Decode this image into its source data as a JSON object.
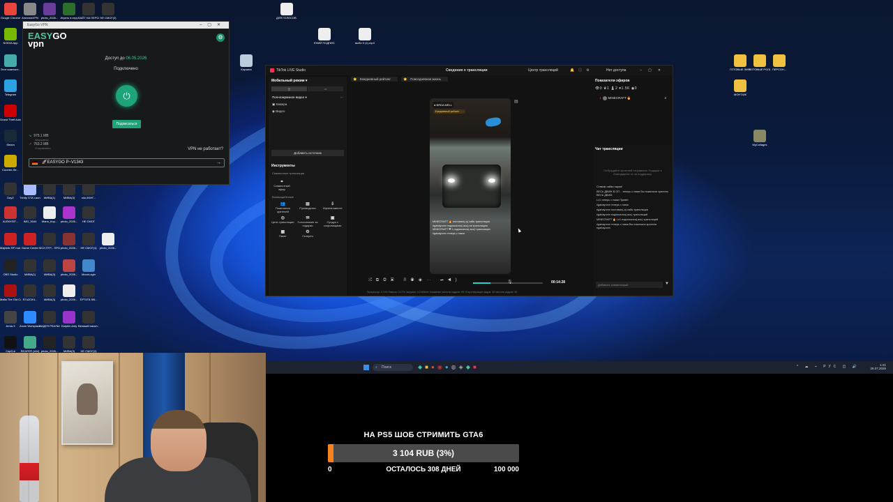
{
  "desktop": {
    "icons": [
      {
        "label": "Google Chrome",
        "color": "#e8453c"
      },
      {
        "label": "AmneziaVPN",
        "color": "#888"
      },
      {
        "label": "photo_2026...",
        "color": "#6a3d9a"
      },
      {
        "label": "Играть в игру",
        "color": "#2c6e2c"
      },
      {
        "label": "БАЙТ НА ПЕРСОН...",
        "color": "#333"
      },
      {
        "label": "НЕ СМОГ(2)",
        "color": "#333"
      },
      {
        "label": "ДЛЯ ГОЛОСОВ...",
        "color": "#eee"
      },
      {
        "label": "Корзина",
        "color": "#bcd"
      },
      {
        "label": "ЕНИЙ ПОДПИСКА...",
        "color": "#eee"
      },
      {
        "label": "выбо 0 (1).mp4",
        "color": "#eee"
      },
      {
        "label": "ГОТОВЫЕ ЛИФС",
        "color": "#f0c040"
      },
      {
        "label": "ГОТОВЫЕ РОЛИКИ",
        "color": "#f0c040"
      },
      {
        "label": "ПЕРСОН...",
        "color": "#f0c040"
      },
      {
        "label": "МОНТАЖ",
        "color": "#f0c040"
      },
      {
        "label": "MyCollages",
        "color": "#886"
      },
      {
        "label": "NVIDIA App",
        "color": "#76b900"
      },
      {
        "label": "Этот компьют...",
        "color": "#4aa"
      },
      {
        "label": "Telegram",
        "color": "#2aa3e0"
      },
      {
        "label": "Grand Theft Auto III - T...",
        "color": "#c00"
      },
      {
        "label": "Steam",
        "color": "#1b2838"
      },
      {
        "label": "Counter-Str...",
        "color": "#ca0"
      },
      {
        "label": "DayZ",
        "color": "#333"
      },
      {
        "label": "Trinity GTA Launcher",
        "color": "#abf"
      },
      {
        "label": "МИВА(1)",
        "color": "#333"
      },
      {
        "label": "МИВА(3)",
        "color": "#333"
      },
      {
        "label": "o4u;8ЧНГ...",
        "color": "#333"
      },
      {
        "label": "ALEKKSIT...",
        "color": "#c33"
      },
      {
        "label": "IMG_3044",
        "color": "#333"
      },
      {
        "label": "Мано_Кор...",
        "color": "#eee"
      },
      {
        "label": "photo_2026...",
        "color": "#a3c"
      },
      {
        "label": "НЕ СМОГ",
        "color": "#333"
      },
      {
        "label": "Majestic RP mai.10",
        "color": "#c22"
      },
      {
        "label": "Game Center",
        "color": "#c22"
      },
      {
        "label": "МСХ;ПТР... ПРО СВО...",
        "color": "#333"
      },
      {
        "label": "photo_2026...",
        "color": "#833"
      },
      {
        "label": "НЕ СМОГ(1)",
        "color": "#333"
      },
      {
        "label": "photo_2026...",
        "color": "#eee"
      },
      {
        "label": "OBS Studio",
        "color": "#222"
      },
      {
        "label": "МИВА(1)",
        "color": "#333"
      },
      {
        "label": "МИВА(3)",
        "color": "#333"
      },
      {
        "label": "photo_2026...",
        "color": "#b44"
      },
      {
        "label": "MoonLogin",
        "color": "#48c"
      },
      {
        "label": "Mafia The Old Country",
        "color": "#a11"
      },
      {
        "label": "R7u2СКЧ...",
        "color": "#333"
      },
      {
        "label": "МИВА(3)",
        "color": "#333"
      },
      {
        "label": "photo_2026...",
        "color": "#eee"
      },
      {
        "label": "ЕРТ4Т8-Ф8...",
        "color": "#333"
      },
      {
        "label": "Arma 3",
        "color": "#444"
      },
      {
        "label": "Zoom Workplace",
        "color": "#2d8cff"
      },
      {
        "label": "НАДЕЯ РЕАЛЬН...",
        "color": "#333"
      },
      {
        "label": "Dolphin Anty",
        "color": "#93c"
      },
      {
        "label": "Великий начал...",
        "color": "#333"
      },
      {
        "label": "CapCut",
        "color": "#111"
      },
      {
        "label": "REAPER (x64)",
        "color": "#4a8"
      },
      {
        "label": "photo_2026...",
        "color": "#222"
      },
      {
        "label": "МИВА(3)",
        "color": "#333"
      },
      {
        "label": "НЕ СМОГ(2)",
        "color": "#333"
      }
    ]
  },
  "vpn": {
    "window_title": "EasyGo VPN",
    "logo_top_a": "EASY",
    "logo_top_b": "GO",
    "logo_bottom": "vpn",
    "access_prefix": "Доступ до ",
    "access_date": "06.05.2026",
    "status": "Подключено",
    "subscribe_label": "Подписаться",
    "download": "975.1 MB",
    "download_label": "Загружено",
    "upload": "763.2 MB",
    "upload_label": "Отправлено",
    "not_working": "VPN не работает?",
    "server": "🚀EASYGO P~V1343"
  },
  "tiktok": {
    "app_title": "TikTok LIVE Studio",
    "window_center_title": "Сведения о трансляции",
    "live_center": "Центр трансляций",
    "username": "Нет доступа",
    "mode": "Мобильный режим",
    "fullscreen_video": "Полноэкранное видео",
    "source_camera": "Камера",
    "source_video": "Видео",
    "add_source": "Добавить источник",
    "tools_title": "Инструменты",
    "co_stream": "Совместные трансляции",
    "co_stream_btn": "Совместный эфир",
    "interaction": "Взаимодействие",
    "tools": [
      {
        "icon": "👥",
        "label": "Пожелания зрителей"
      },
      {
        "icon": "▤",
        "label": "Руководство"
      },
      {
        "icon": "⇩",
        "label": "Играем вместе"
      },
      {
        "icon": "◎",
        "label": "Цель трансляции"
      },
      {
        "icon": "✉",
        "label": "Голосование за подарки"
      },
      {
        "icon": "▣",
        "label": "Сундук с сокровищами"
      },
      {
        "icon": "▦",
        "label": "Пакет"
      },
      {
        "icon": "⚙",
        "label": "Галерея"
      }
    ],
    "pill_daily": "Ежедневный рейтинг",
    "pill_life": "Повседневная жизнь",
    "host_name": "BRDA MELL",
    "overlay_chat": [
      "MINECRAFT 🔥 поставил(-а) лайк трансляции",
      "rigabayonm подписался(-ась) на трансляцию",
      "MINECRAFT ❤ 1 подписался(-ась) трансляция",
      "rigabayonm теперь с нами"
    ],
    "timer": "00:14:28",
    "status_line": "Процессор: 3.74%   Память: 3.17%   Загрузка: 4.2 Мбит/с   Снижение частоты кадров: 0%   Отсутствующие кадры: 36   Частота кадров: 30",
    "viewer_title": "Показатели эфиров",
    "stats": "👁0  ♛1  ♟2  ♥1.5K  ◉0",
    "top_viewer_rank": "1",
    "top_viewer": "MINECRAFT 🔥",
    "top_viewer_score": "2",
    "chat_title": "Чат трансляции",
    "chat_empty": "Побуждайте зрителей отправлять Подарки и благодарите их за поддержку.",
    "chat_messages": [
      "Ставим лайки парни!",
      "ВЕСЬ ДВИЖ В ОП... теперь с нами Вы пожелали зрителю ВЕСЬ ДВИЖ",
      "Lv1 теперь с нами   Привет",
      "rigabayonm теперь с нами",
      "rigabayonm поставил(-а) лайк трансляции",
      "rigabayonm подписался(-ась) трансляций",
      "MINECRAFT 🔥 Lv1 подписался(-ась) трансляций",
      "rigabayonm теперь с нами Вы пожелали зрителю rigabayonm"
    ],
    "comment_placeholder": "Добавить комментарий"
  },
  "taskbar": {
    "search": "Поиск",
    "lang": "РУС",
    "time": "1:21",
    "date": "26.07.2026"
  },
  "goal": {
    "title": "НА PS5 ШОБ СТРИМИТЬ GTA6",
    "amount_text": "3 104 RUB (3%)",
    "progress_fraction": 0.03,
    "min": "0",
    "remaining": "ОСТАЛОСЬ 308 ДНЕЙ",
    "max": "100 000",
    "accent": "#f5821f"
  }
}
